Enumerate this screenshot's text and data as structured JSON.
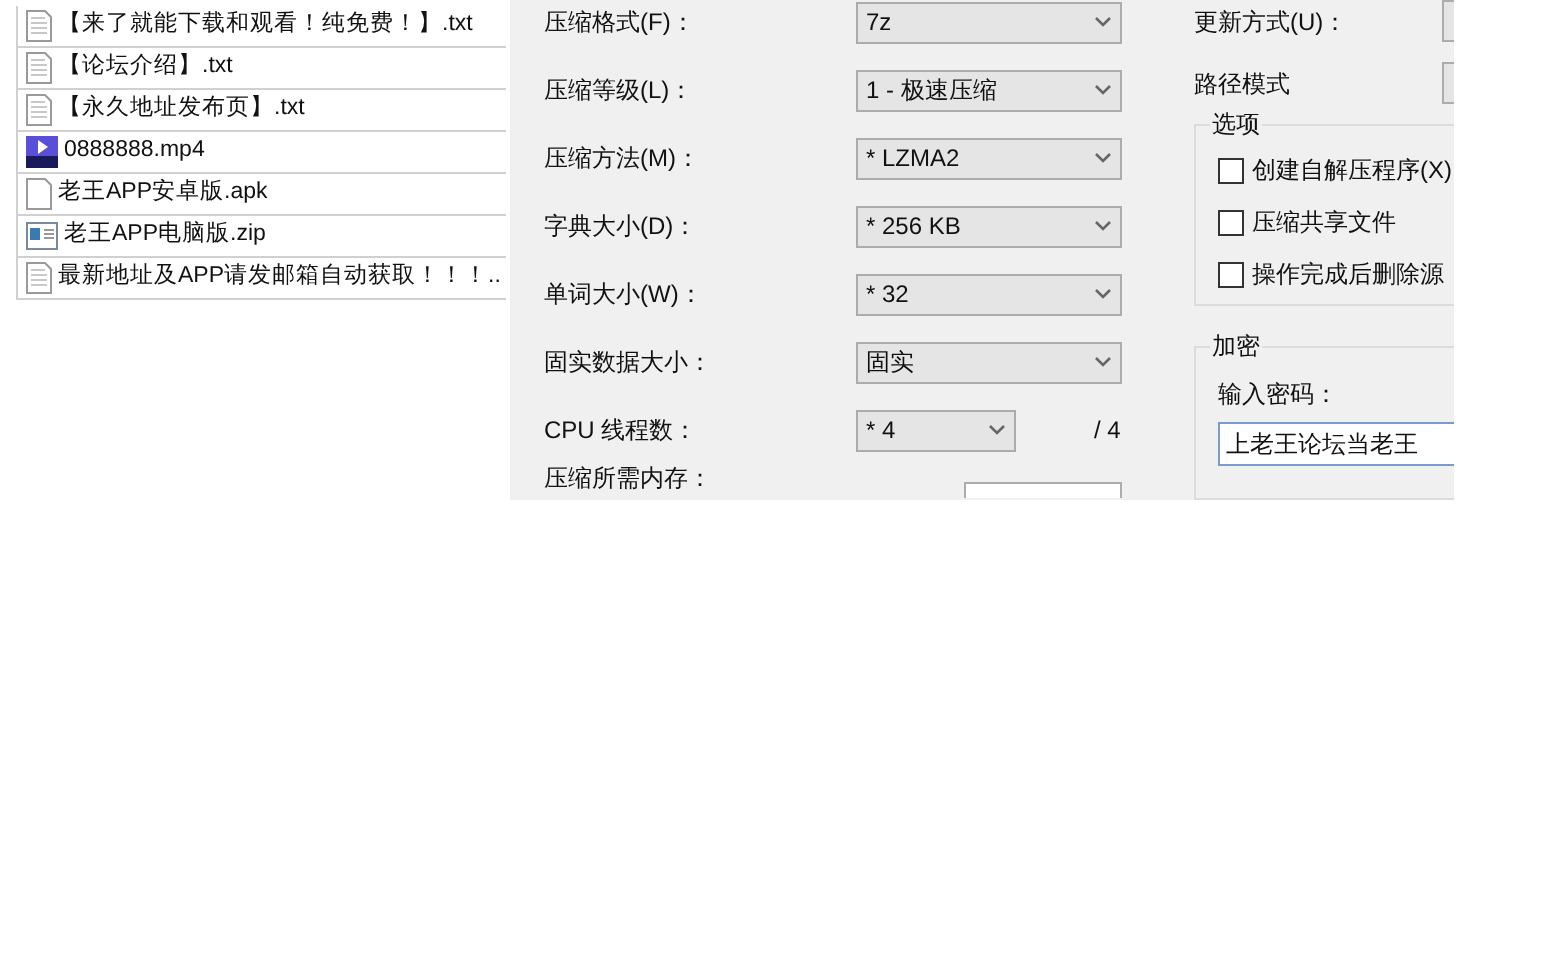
{
  "files": [
    {
      "kind": "text",
      "name": "【来了就能下载和观看！纯免费！】.txt"
    },
    {
      "kind": "text",
      "name": "【论坛介绍】.txt"
    },
    {
      "kind": "text",
      "name": "【永久地址发布页】.txt"
    },
    {
      "kind": "video",
      "name": "0888888.mp4"
    },
    {
      "kind": "blank",
      "name": "老王APP安卓版.apk"
    },
    {
      "kind": "archive",
      "name": "老王APP电脑版.zip"
    },
    {
      "kind": "text",
      "name": "最新地址及APP请发邮箱自动获取！！！.."
    }
  ],
  "settings": [
    {
      "label": "压缩格式(F)：",
      "value": "7z"
    },
    {
      "label": "压缩等级(L)：",
      "value": "1 - 极速压缩"
    },
    {
      "label": "压缩方法(M)：",
      "value": "* LZMA2"
    },
    {
      "label": "字典大小(D)：",
      "value": "* 256 KB"
    },
    {
      "label": "单词大小(W)：",
      "value": "* 32"
    },
    {
      "label": "固实数据大小：",
      "value": "固实"
    },
    {
      "label": "CPU 线程数：",
      "value": "* 4",
      "suffix": "/ 4"
    },
    {
      "label": "压缩所需内存："
    }
  ],
  "update_mode": {
    "label": "更新方式(U)："
  },
  "path_mode": {
    "label": "路径模式"
  },
  "options": {
    "title": "选项",
    "items": [
      {
        "label": "创建自解压程序(X)",
        "checked": false
      },
      {
        "label": "压缩共享文件",
        "checked": false
      },
      {
        "label": "操作完成后删除源",
        "checked": false
      }
    ]
  },
  "encryption": {
    "title": "加密",
    "label": "输入密码：",
    "value": "上老王论坛当老王"
  }
}
